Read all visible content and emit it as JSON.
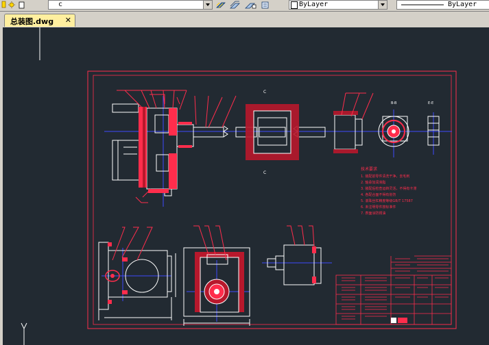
{
  "toolbar": {
    "layer_combo_value": "c",
    "color_combo_value": "ByLayer",
    "linetype_combo_value": "ByLayer"
  },
  "tab": {
    "title": "总装图.dwg",
    "close_label": "✕"
  },
  "drawing": {
    "section_label_top": "C",
    "section_label_bottom": "C",
    "label_left_view": "B-B",
    "label_right_view": "E-E",
    "tech_title": "技术要求",
    "tech_requirements": [
      "1. 装配前零件清洗干净，去毛刺",
      "2. 轴承加润滑脂",
      "3. 装配后检查运转灵活，不得有卡滞",
      "4. 各配合面不得有划伤",
      "5. 滚珠丝杠精度等级GB/T 17587",
      "6. 未注明零件按标准件",
      "7. 表面涂防锈油"
    ],
    "ucs_y_label": "Y"
  },
  "colors": {
    "canvas_bg": "#222a32",
    "frame": "#ff2d4c",
    "geometry": "#ffffff",
    "centerline": "#3e4bff",
    "tab_bg": "#ffef9f"
  }
}
